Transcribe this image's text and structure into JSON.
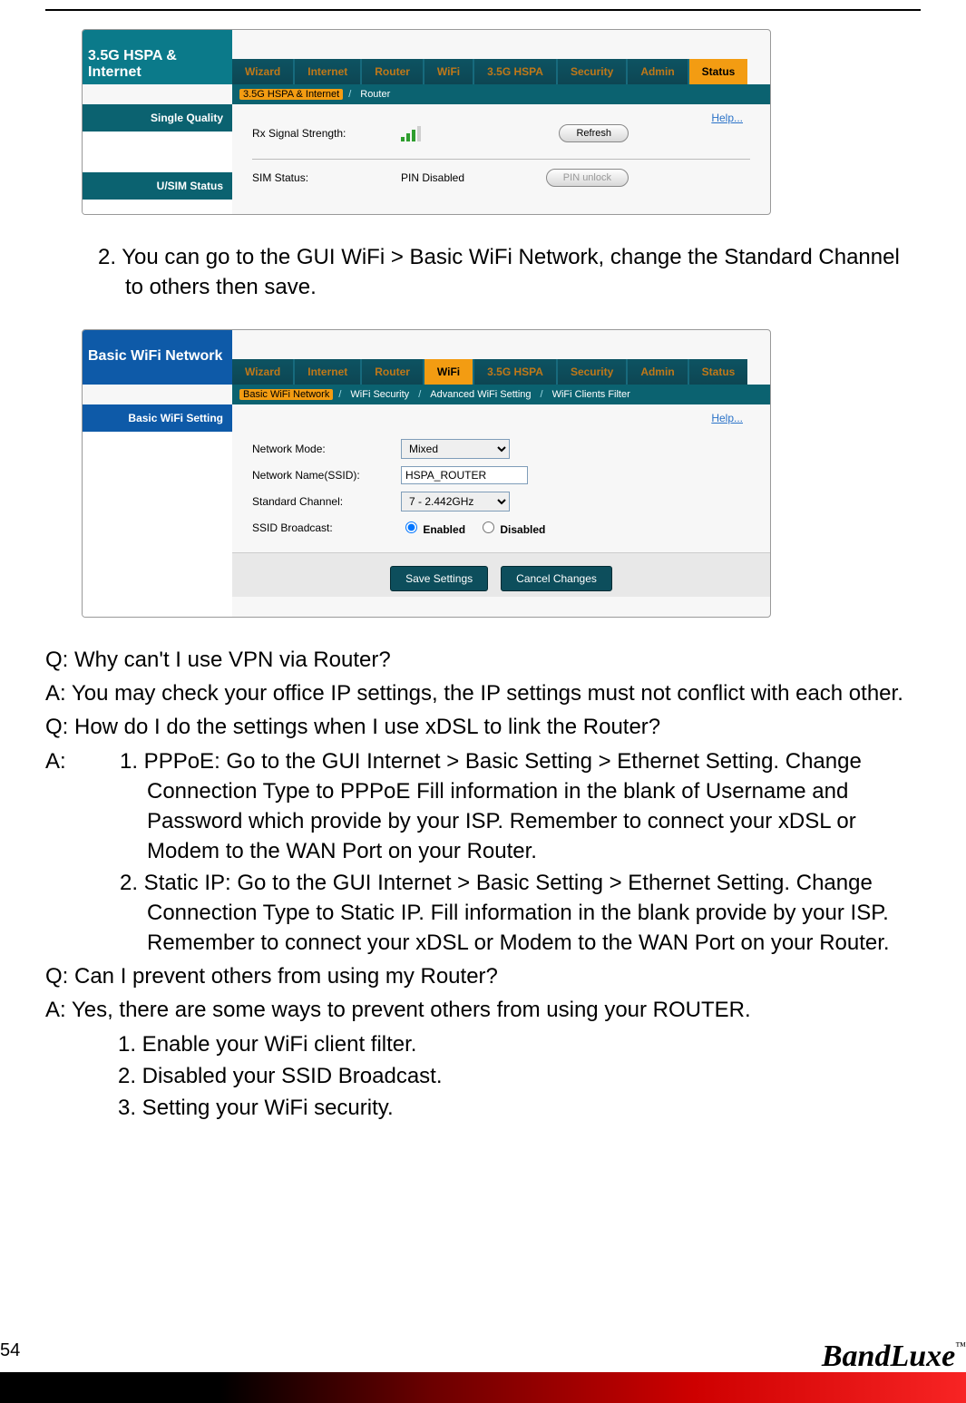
{
  "panel1": {
    "title": "3.5G HSPA & Internet",
    "tabs": [
      "Wizard",
      "Internet",
      "Router",
      "WiFi",
      "3.5G HSPA",
      "Security",
      "Admin",
      "Status"
    ],
    "subtabs": {
      "a": "3.5G HSPA & Internet",
      "b": "Router"
    },
    "side": {
      "item1": "Single Quality",
      "item2": "U/SIM Status"
    },
    "help": "Help...",
    "rx_label": "Rx Signal Strength:",
    "refresh": "Refresh",
    "sim_label": "SIM Status:",
    "sim_value": "PIN Disabled",
    "pin_unlock": "PIN unlock"
  },
  "intro_step": "2. You can go to the GUI WiFi > Basic WiFi Network, change the Standard Channel to others then save.",
  "panel2": {
    "title": "Basic WiFi Network",
    "tabs": [
      "Wizard",
      "Internet",
      "Router",
      "WiFi",
      "3.5G HSPA",
      "Security",
      "Admin",
      "Status"
    ],
    "subtabs": [
      "Basic WiFi Network",
      "WiFi Security",
      "Advanced WiFi Setting",
      "WiFi Clients Filter"
    ],
    "side": {
      "item1": "Basic WiFi Setting"
    },
    "help": "Help...",
    "fields": {
      "mode_label": "Network Mode:",
      "mode_value": "Mixed",
      "ssid_label": "Network Name(SSID):",
      "ssid_value": "HSPA_ROUTER",
      "channel_label": "Standard Channel:",
      "channel_value": "7 - 2.442GHz",
      "broadcast_label": "SSID Broadcast:",
      "enabled_label": "Enabled",
      "disabled_label": "Disabled"
    },
    "save": "Save Settings",
    "cancel": "Cancel Changes"
  },
  "qa1": {
    "q": "Q: Why can't I use VPN via Router?",
    "a": "A:    You may check your office IP settings, the IP settings must not conflict with each other."
  },
  "qa2": {
    "q": "Q: How do I do the settings when I use xDSL to link the Router?",
    "a_prefix": "A:",
    "item1": "1. PPPoE: Go to the GUI Internet > Basic Setting > Ethernet Setting. Change Connection Type to PPPoE Fill information in the blank of Username and Password which provide by your ISP. Remember to connect your xDSL or Modem to the WAN Port on your Router.",
    "item2": "2. Static IP: Go to the GUI Internet > Basic Setting > Ethernet Setting. Change Connection Type to Static IP. Fill information in the blank provide by your ISP. Remember to connect your xDSL or Modem to the WAN Port on your Router."
  },
  "qa3": {
    "q": "Q: Can I prevent others from using my Router?",
    "a": "A:    Yes, there are some ways to prevent others from using your ROUTER.",
    "l1": "1. Enable your WiFi client filter.",
    "l2": "2. Disabled your SSID Broadcast.",
    "l3": "3. Setting your WiFi security."
  },
  "page_number": "54",
  "brand": "BandLuxe",
  "tm": "™"
}
